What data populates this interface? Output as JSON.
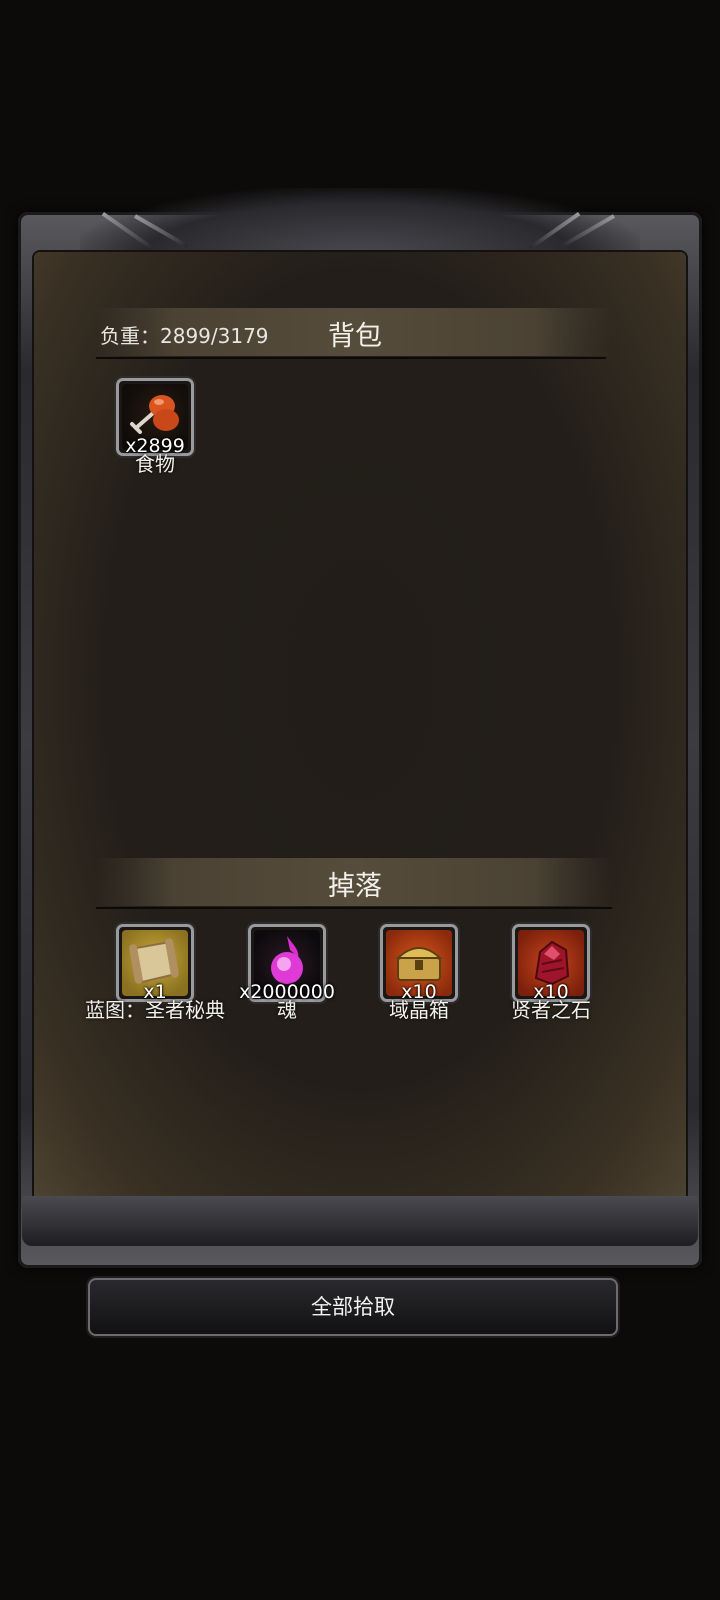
{
  "backpack": {
    "weight_label": "负重：2899/3179",
    "title": "背包",
    "items": [
      {
        "name": "食物",
        "qty": "x2899",
        "icon": "food-icon"
      }
    ]
  },
  "drops": {
    "title": "掉落",
    "items": [
      {
        "name": "蓝图：圣者秘典",
        "qty": "x1",
        "icon": "scroll-icon"
      },
      {
        "name": "魂",
        "qty": "x2000000",
        "icon": "soul-orb-icon"
      },
      {
        "name": "域晶箱",
        "qty": "x10",
        "icon": "treasure-chest-icon"
      },
      {
        "name": "贤者之石",
        "qty": "x10",
        "icon": "sage-stone-icon"
      }
    ]
  },
  "actions": {
    "pickup_all": "全部拾取"
  }
}
